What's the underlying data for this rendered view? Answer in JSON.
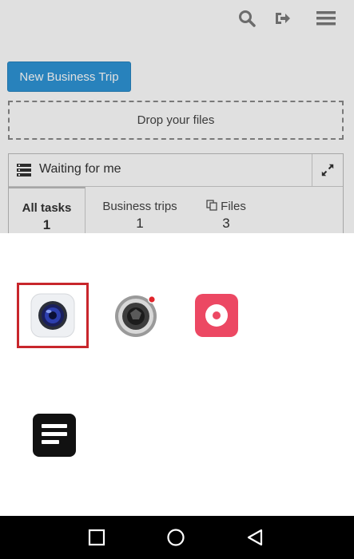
{
  "app": {
    "new_trip_label": "New Business Trip",
    "dropzone_label": "Drop your files",
    "panel": {
      "title": "Waiting for me",
      "tabs": [
        {
          "label": "All tasks",
          "count": "1",
          "active": true
        },
        {
          "label": "Business trips",
          "count": "1",
          "active": false
        },
        {
          "label": "Files",
          "count": "3",
          "active": false
        }
      ]
    },
    "colors": {
      "primary": "#2e95d6",
      "dim_overlay": "rgba(0,0,0,0.12)"
    }
  },
  "chooser": {
    "apps": [
      {
        "icon": "camera-app-icon",
        "selected": true
      },
      {
        "icon": "video-camera-app-icon",
        "selected": false
      },
      {
        "icon": "sound-recorder-app-icon",
        "selected": false
      },
      {
        "icon": "notes-app-icon",
        "selected": false
      }
    ],
    "selection_color": "#c8262c"
  },
  "navbar": {
    "buttons": [
      "recents-button",
      "home-button",
      "back-button"
    ]
  }
}
